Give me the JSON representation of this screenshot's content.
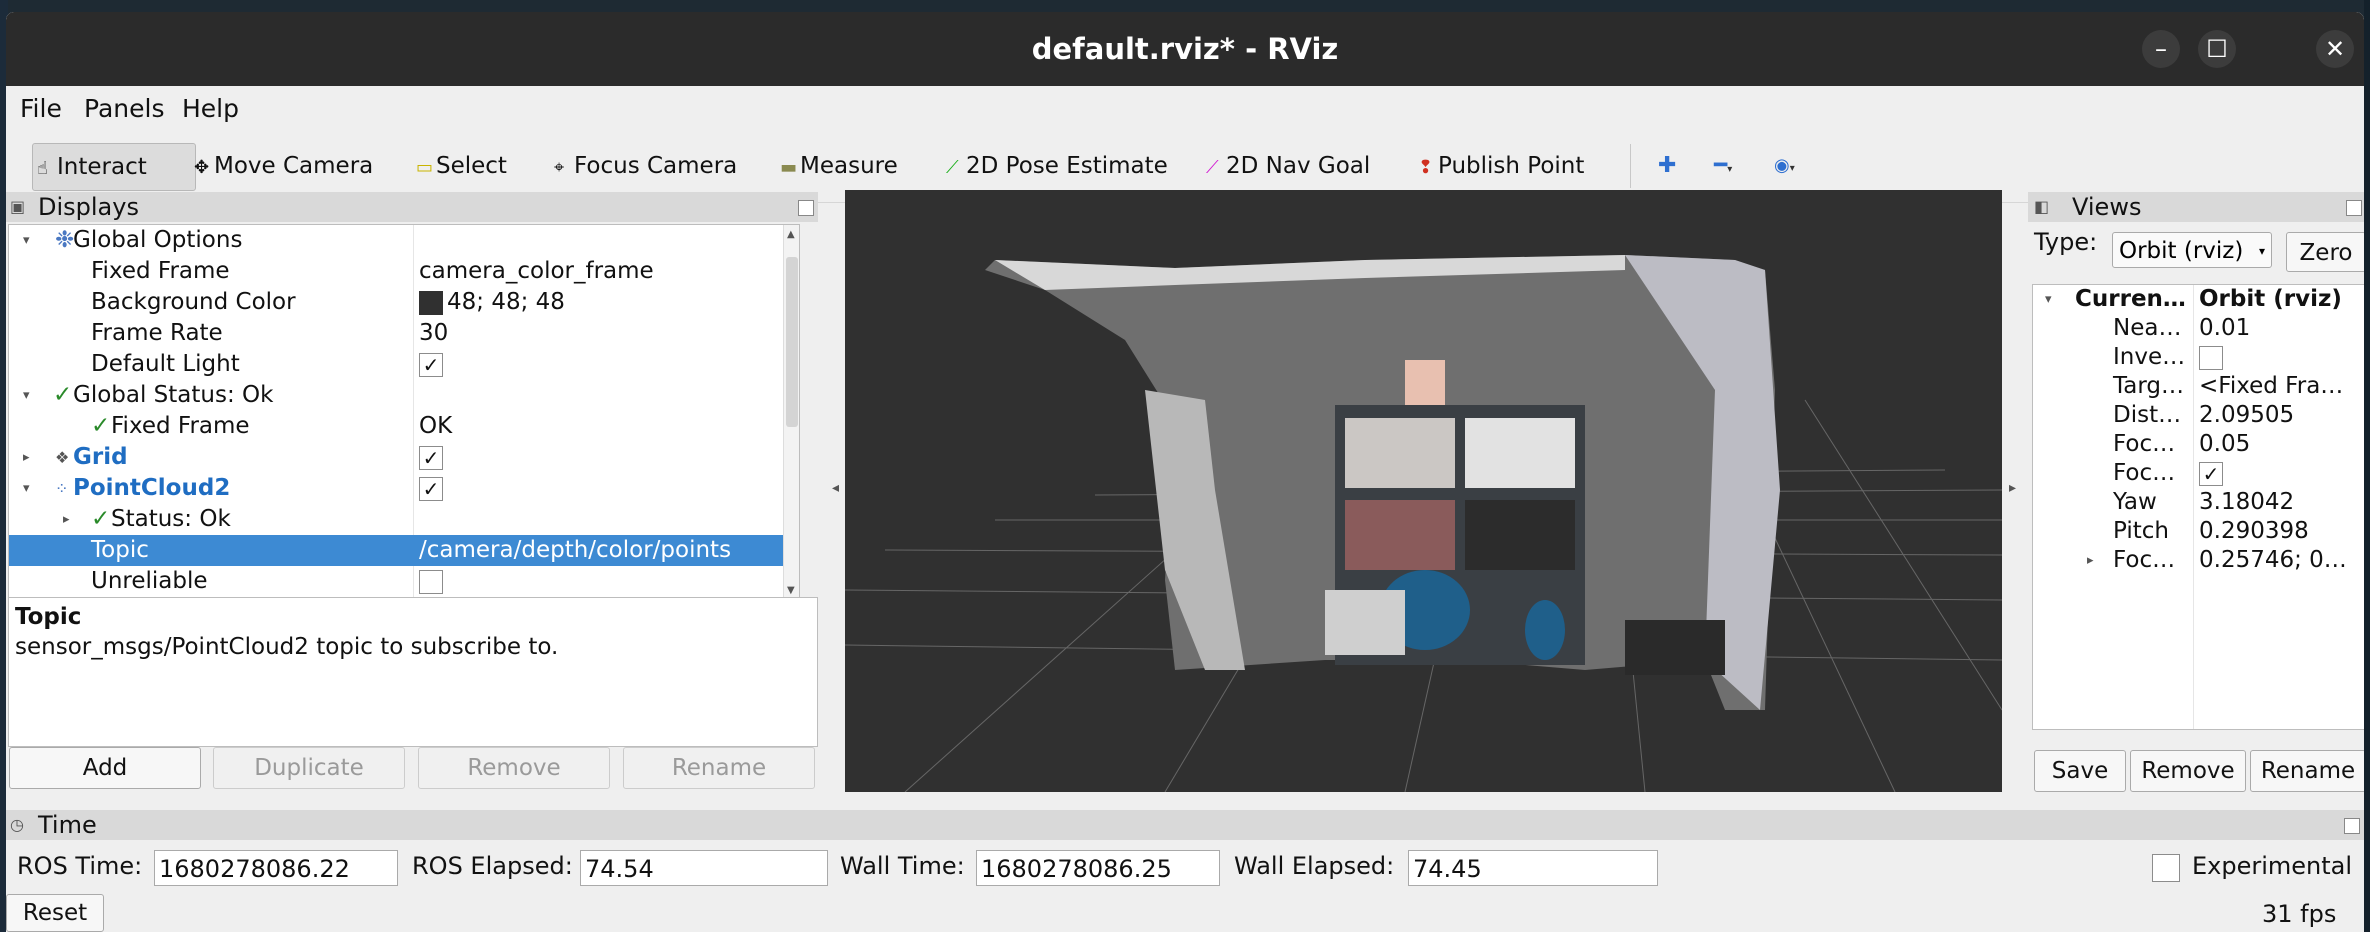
{
  "window": {
    "title": "default.rviz* - RViz"
  },
  "menu": [
    "File",
    "Panels",
    "Help"
  ],
  "toolbar": {
    "interact": "Interact",
    "move_camera": "Move Camera",
    "select": "Select",
    "focus_camera": "Focus Camera",
    "measure": "Measure",
    "pose_estimate": "2D Pose Estimate",
    "nav_goal": "2D Nav Goal",
    "publish_point": "Publish Point",
    "active": "Interact"
  },
  "displays": {
    "title": "Displays",
    "rows": {
      "global_options": "Global Options",
      "fixed_frame_label": "Fixed Frame",
      "fixed_frame_value": "camera_color_frame",
      "bg_color_label": "Background Color",
      "bg_color_value": "48; 48; 48",
      "frame_rate_label": "Frame Rate",
      "frame_rate_value": "30",
      "default_light_label": "Default Light",
      "global_status": "Global Status: Ok",
      "status_fixed_frame_label": "Fixed Frame",
      "status_fixed_frame_value": "OK",
      "grid_label": "Grid",
      "pointcloud_label": "PointCloud2",
      "status_label": "Status: Ok",
      "topic_label": "Topic",
      "topic_value": "/camera/depth/color/points",
      "unreliable_label": "Unreliable"
    },
    "checks": {
      "default_light": true,
      "grid": true,
      "pointcloud": true,
      "unreliable": false
    },
    "description": {
      "title": "Topic",
      "text": "sensor_msgs/PointCloud2 topic to subscribe to."
    },
    "buttons": {
      "add": "Add",
      "duplicate": "Duplicate",
      "remove": "Remove",
      "rename": "Rename"
    }
  },
  "views": {
    "title": "Views",
    "type_label": "Type:",
    "type_value": "Orbit (rviz)",
    "zero": "Zero",
    "rows": [
      {
        "k": "Curren…",
        "v": "Orbit (rviz)"
      },
      {
        "k": "Nea…",
        "v": "0.01"
      },
      {
        "k": "Inve…",
        "v": ""
      },
      {
        "k": "Targ…",
        "v": "<Fixed Fra…"
      },
      {
        "k": "Dist…",
        "v": "2.09505"
      },
      {
        "k": "Foc…",
        "v": "0.05"
      },
      {
        "k": "Foc…",
        "v": ""
      },
      {
        "k": "Yaw",
        "v": "3.18042"
      },
      {
        "k": "Pitch",
        "v": "0.290398"
      },
      {
        "k": "Foc…",
        "v": "0.25746; 0…"
      }
    ],
    "buttons": {
      "save": "Save",
      "remove": "Remove",
      "rename": "Rename"
    }
  },
  "time": {
    "title": "Time",
    "ros_time_label": "ROS Time:",
    "ros_time": "1680278086.22",
    "ros_elapsed_label": "ROS Elapsed:",
    "ros_elapsed": "74.54",
    "wall_time_label": "Wall Time:",
    "wall_time": "1680278086.25",
    "wall_elapsed_label": "Wall Elapsed:",
    "wall_elapsed": "74.45",
    "experimental": "Experimental",
    "reset": "Reset",
    "fps": "31 fps"
  },
  "colors": {
    "selection": "#3d8ad3",
    "view_background": "#303030",
    "title_bar": "#2b2b2b"
  }
}
